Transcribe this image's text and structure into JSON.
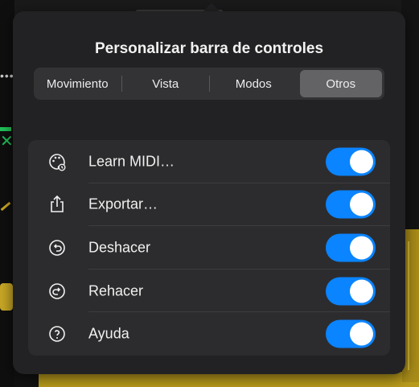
{
  "popover": {
    "title": "Personalizar barra de controles",
    "tabs": [
      {
        "label": "Movimiento",
        "selected": false
      },
      {
        "label": "Vista",
        "selected": false
      },
      {
        "label": "Modos",
        "selected": false
      },
      {
        "label": "Otros",
        "selected": true
      }
    ],
    "items": [
      {
        "label": "Learn MIDI…",
        "icon": "midi-learn-icon",
        "enabled": true
      },
      {
        "label": "Exportar…",
        "icon": "share-export-icon",
        "enabled": true
      },
      {
        "label": "Deshacer",
        "icon": "undo-icon",
        "enabled": true
      },
      {
        "label": "Rehacer",
        "icon": "redo-icon",
        "enabled": true
      },
      {
        "label": "Ayuda",
        "icon": "help-icon",
        "enabled": true
      }
    ]
  },
  "colors": {
    "popover_bg": "#222224",
    "list_bg": "#2c2c2e",
    "toggle_on": "#0a84ff",
    "segment_selected": "#636366"
  }
}
